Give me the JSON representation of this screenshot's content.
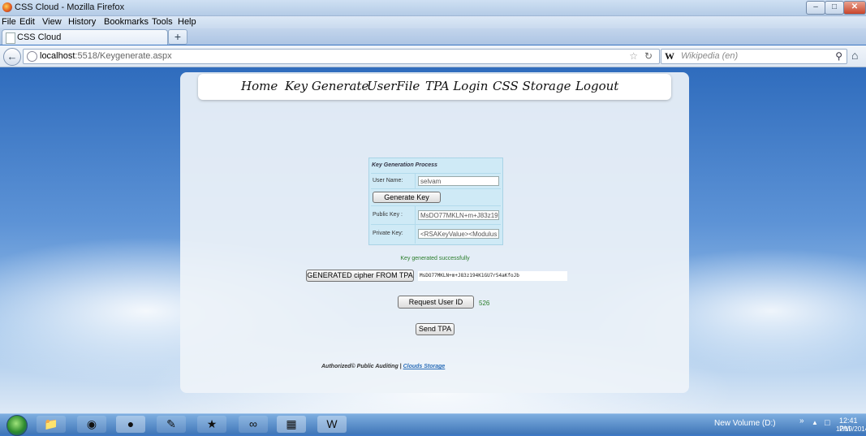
{
  "window": {
    "title": "CSS Cloud - Mozilla Firefox"
  },
  "menu": [
    "File",
    "Edit",
    "View",
    "History",
    "Bookmarks",
    "Tools",
    "Help"
  ],
  "tab": {
    "title": "CSS Cloud",
    "new_tab": "+"
  },
  "address": {
    "host": "localhost",
    "path": ":5518/Keygenerate.aspx"
  },
  "search": {
    "engine": "W",
    "placeholder": "Wikipedia (en)"
  },
  "nav": [
    "Home",
    "Key Generate",
    "UserFile",
    "TPA Login",
    "CSS Storage",
    "Logout"
  ],
  "form": {
    "caption": "Key Generation Process",
    "username_label": "User Name:",
    "username_value": "selvam",
    "generate_button": "Generate Key",
    "public_key_label": "Public Key :",
    "public_key_value": "MsDO77MKLN+m+J83z19",
    "private_key_label": "Private Key:",
    "private_key_value": "<RSAKeyValue><Modulus"
  },
  "status_message": "Key generated successfully",
  "cipher": {
    "button": "GENERATED cipher FROM TPA",
    "value": "MsDO77MKLN+m+J83z194K1GU7r54aKfoJb"
  },
  "request": {
    "button": "Request User ID",
    "user_id": "526"
  },
  "send_button": "Send TPA",
  "footer": {
    "text": "Authorized© Public Auditing | ",
    "link": "Clouds Storage"
  },
  "taskbar": {
    "volume": "New Volume (D:)",
    "time": "12:41 PM",
    "date": "12/19/2014",
    "icons": [
      "explorer-icon",
      "chrome-icon",
      "firefox-icon",
      "notepad-icon",
      "paint-icon",
      "db-icon",
      "visual-studio-icon",
      "word-icon"
    ]
  }
}
